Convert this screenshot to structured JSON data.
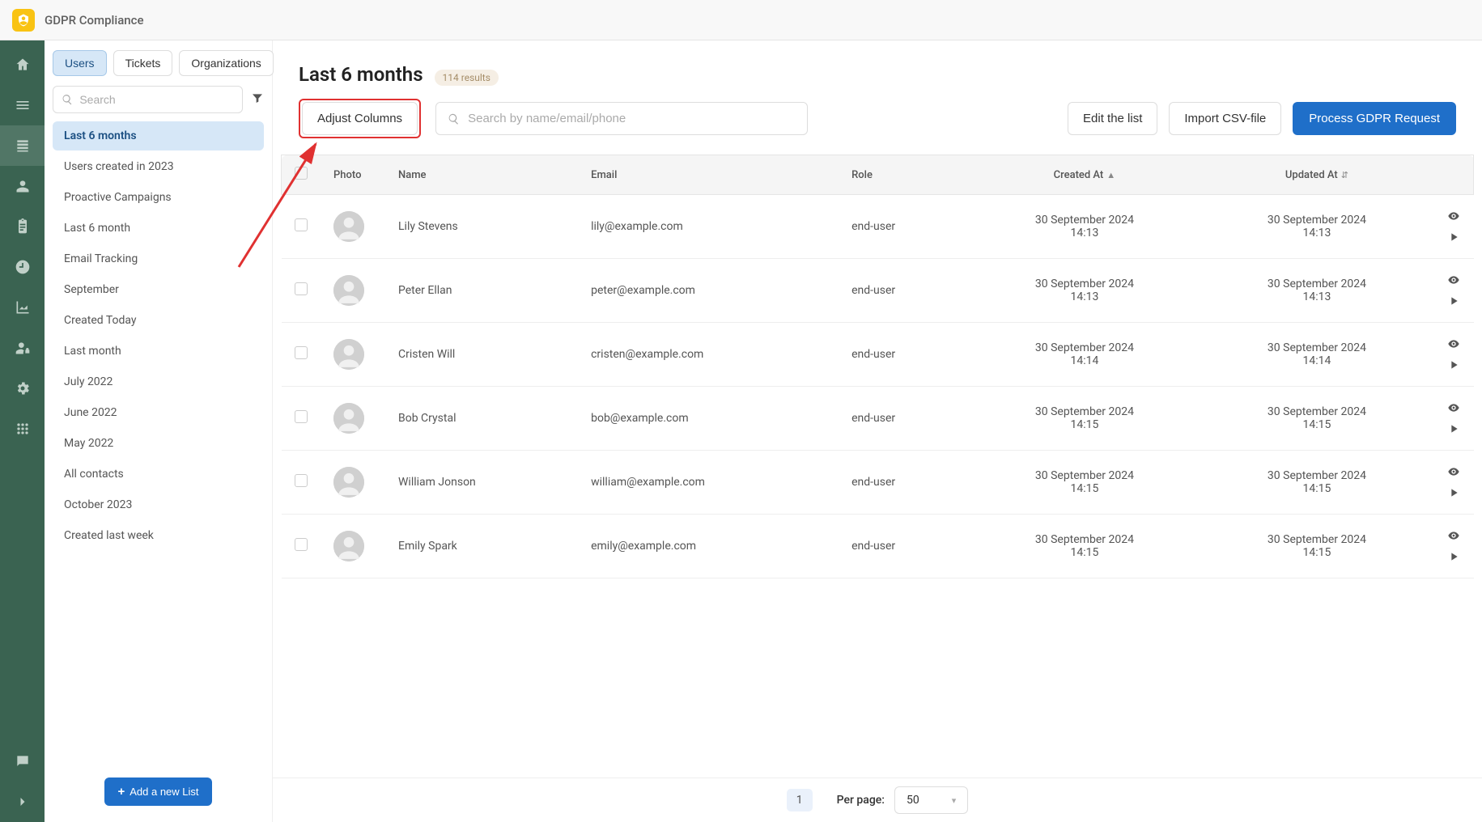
{
  "app": {
    "title": "GDPR Compliance"
  },
  "rail": {
    "items": [
      "home",
      "menu",
      "list",
      "profile",
      "clipboard",
      "clock",
      "chart",
      "user-lock",
      "gear",
      "grid"
    ],
    "bottom": [
      "chat",
      "chevron-right"
    ],
    "active_index": 2
  },
  "sidebar": {
    "tabs": [
      "Users",
      "Tickets",
      "Organizations"
    ],
    "active_tab": 0,
    "search_placeholder": "Search",
    "lists": [
      "Last 6 months",
      "Users created in 2023",
      "Proactive Campaigns",
      "Last 6 month",
      "Email Tracking",
      "September",
      "Created Today",
      "Last month",
      "July 2022",
      "June 2022",
      "May 2022",
      "All contacts",
      "October 2023",
      "Created last week"
    ],
    "active_list": 0,
    "add_list_label": "Add a new List"
  },
  "main": {
    "title": "Last 6 months",
    "results_badge": "114 results",
    "adjust_columns_label": "Adjust Columns",
    "search_placeholder": "Search by name/email/phone",
    "edit_list_label": "Edit the list",
    "import_csv_label": "Import CSV-file",
    "process_gdpr_label": "Process GDPR Request"
  },
  "table": {
    "headers": {
      "photo": "Photo",
      "name": "Name",
      "email": "Email",
      "role": "Role",
      "created_at": "Created At",
      "updated_at": "Updated At"
    },
    "rows": [
      {
        "name": "Lily Stevens",
        "email": "lily@example.com",
        "role": "end-user",
        "created": "30 September 2024",
        "created_time": "14:13",
        "updated": "30 September 2024",
        "updated_time": "14:13"
      },
      {
        "name": "Peter Ellan",
        "email": "peter@example.com",
        "role": "end-user",
        "created": "30 September 2024",
        "created_time": "14:13",
        "updated": "30 September 2024",
        "updated_time": "14:13"
      },
      {
        "name": "Cristen Will",
        "email": "cristen@example.com",
        "role": "end-user",
        "created": "30 September 2024",
        "created_time": "14:14",
        "updated": "30 September 2024",
        "updated_time": "14:14"
      },
      {
        "name": "Bob Crystal",
        "email": "bob@example.com",
        "role": "end-user",
        "created": "30 September 2024",
        "created_time": "14:15",
        "updated": "30 September 2024",
        "updated_time": "14:15"
      },
      {
        "name": "William Jonson",
        "email": "william@example.com",
        "role": "end-user",
        "created": "30 September 2024",
        "created_time": "14:15",
        "updated": "30 September 2024",
        "updated_time": "14:15"
      },
      {
        "name": "Emily Spark",
        "email": "emily@example.com",
        "role": "end-user",
        "created": "30 September 2024",
        "created_time": "14:15",
        "updated": "30 September 2024",
        "updated_time": "14:15"
      }
    ]
  },
  "pagination": {
    "page": "1",
    "per_page_label": "Per page:",
    "per_page_value": "50"
  }
}
